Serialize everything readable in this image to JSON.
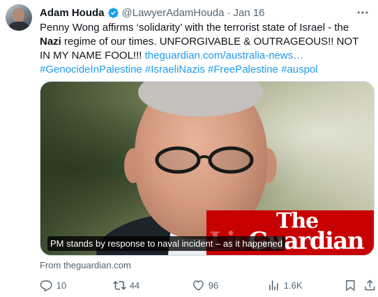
{
  "tweet": {
    "author": {
      "name": "Adam Houda",
      "handle": "@LawyerAdamHouda",
      "verified": true,
      "avatar_icon": "avatar-photo"
    },
    "separator": "·",
    "date": "Jan 16",
    "text": {
      "part1": "Penny Wong affirms ‘solidarity’ with the terrorist state of Israel - the ",
      "bold": "Nazi",
      "part2": " regime of our times. UNFORGIVABLE & OUTRAGEOUS!! NOT IN MY NAME FOOL!!! ",
      "link": "theguardian.com/australia-news…",
      "space": " ",
      "hashtags": [
        "#GenocideInPalestine",
        "#IsraeliNazis",
        "#FreePalestine",
        "#auspol"
      ]
    },
    "card": {
      "caption": "PM stands by response to naval incident – as it happened",
      "brand_line1": "The",
      "brand_line2": "Guardian",
      "brand_overlay": "Live",
      "source": "From theguardian.com"
    },
    "actions": {
      "replies": "10",
      "retweets": "44",
      "likes": "96",
      "views": "1.6K"
    },
    "colors": {
      "accent": "#1d9bf0",
      "muted": "#536471",
      "guardian_red": "#c70000"
    },
    "icons": [
      "verified-badge-icon",
      "more-icon",
      "reply-icon",
      "retweet-icon",
      "like-icon",
      "views-icon",
      "bookmark-icon",
      "share-icon"
    ]
  }
}
